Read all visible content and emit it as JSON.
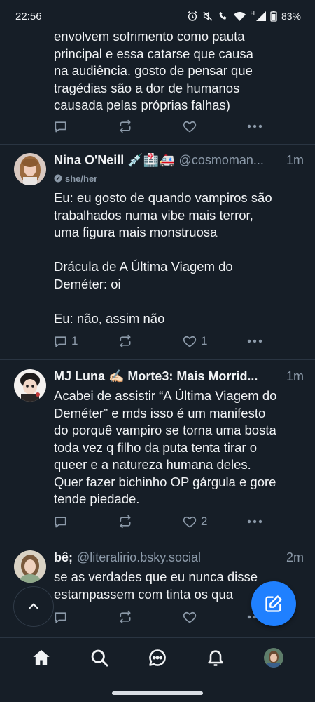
{
  "status_bar": {
    "time": "22:56",
    "battery": "83%",
    "network_letter": "H"
  },
  "partial_post": {
    "text": "envolvem sofrimento como pauta\nprincipal e essa catarse que causa\nna audiência. gosto de pensar que\ntragédias são a dor de humanos\ncausada pelas próprias falhas)"
  },
  "posts": [
    {
      "author": "Nina O'Neill 💉🏥🚑",
      "handle": "@cosmoman...",
      "time": "1m",
      "pronouns": "she/her",
      "text": "Eu: eu gosto de quando vampiros são\ntrabalhados numa vibe mais terror,\numa figura mais monstruosa\n\nDrácula de A Última Viagem do\nDeméter: oi\n\nEu: não, assim não",
      "reply_count": "1",
      "like_count": "1"
    },
    {
      "author": "MJ Luna ✍🏻 Morte3: Mais Morrid...",
      "time": "1m",
      "text": "Acabei de assistir “A Última Viagem do\nDeméter” e mds isso é um manifesto\ndo porquê vampiro se torna uma bosta\ntoda vez q filho da puta tenta tirar o\nqueer e a natureza humana deles.\nQuer fazer bichinho OP gárgula e gore\ntende piedade.",
      "like_count": "2"
    },
    {
      "author": "bê;",
      "handle": "@literalirio.bsky.social",
      "time": "2m",
      "text": "se as verdades que eu nunca disse\nestampassem com tinta os qua"
    }
  ],
  "icons": {
    "reply": "reply-icon",
    "repost": "repost-icon",
    "like": "heart-icon",
    "more": "more-icon",
    "compose": "compose-icon",
    "scroll_top": "chevron-up-icon",
    "nav": [
      "home-icon",
      "search-icon",
      "chat-icon",
      "bell-icon",
      "avatar"
    ]
  },
  "colors": {
    "background": "#161e27",
    "accent": "#1f80ff",
    "muted": "#8c9aa9"
  }
}
